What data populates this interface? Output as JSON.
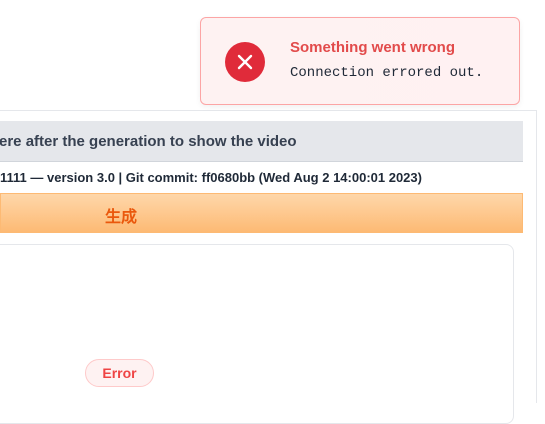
{
  "video_panel": {
    "header_text": "ere after the generation to show the video",
    "version_text": "1111 — version 3.0 | Git commit: ff0680bb (Wed Aug 2 14:00:01 2023)",
    "generate_label": "生成",
    "error_label": "Error"
  },
  "toast": {
    "icon": "close-icon",
    "title": "Something went wrong",
    "message": "Connection errored out."
  },
  "colors": {
    "toast_icon_bg": "#e02b3a",
    "toast_title": "#e24b4b",
    "generate_text": "#ea580c",
    "generate_bg": "#fdba74",
    "error_text": "#ef4444"
  }
}
